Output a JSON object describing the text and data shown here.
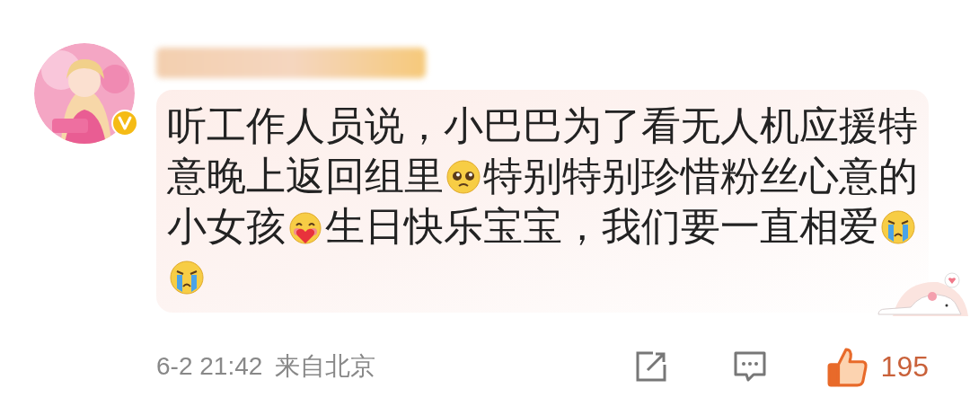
{
  "comment": {
    "verified": true,
    "segments": [
      {
        "kind": "text",
        "text": "听工作人员说，小巴巴为了看无人机应援特意晚上返回组里"
      },
      {
        "kind": "pleading_emoji"
      },
      {
        "kind": "text",
        "text": "特别特别珍惜粉丝心意的小女孩"
      },
      {
        "kind": "hugging_emoji"
      },
      {
        "kind": "text",
        "text": "生日快乐宝宝，我们要一直相爱"
      },
      {
        "kind": "crying_emoji"
      },
      {
        "kind": "crying_emoji"
      }
    ],
    "time": "6-2 21:42",
    "location": "来自北京",
    "liked": true,
    "likes": "195"
  }
}
